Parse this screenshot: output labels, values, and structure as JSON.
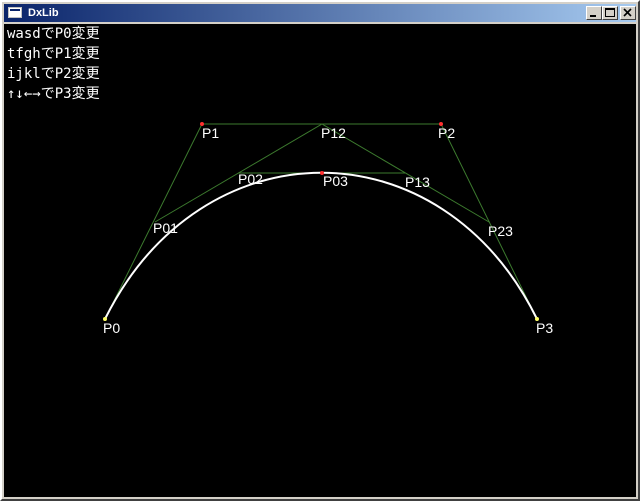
{
  "window": {
    "title": "DxLib"
  },
  "instructions": [
    "wasdでP0変更",
    "tfghでP1変更",
    "ijklでP2変更",
    "↑↓←→でP3変更"
  ],
  "points": {
    "p0": "P0",
    "p1": "P1",
    "p2": "P2",
    "p3": "P3",
    "p01": "P01",
    "p12": "P12",
    "p23": "P23",
    "p02": "P02",
    "p13": "P13",
    "p03": "P03"
  },
  "colors": {
    "background": "#000000",
    "control_line": "#3c7a2e",
    "curve": "#ffffff",
    "end_point": "#ffff66",
    "control_point": "#ff3030",
    "label": "#ffffff"
  }
}
